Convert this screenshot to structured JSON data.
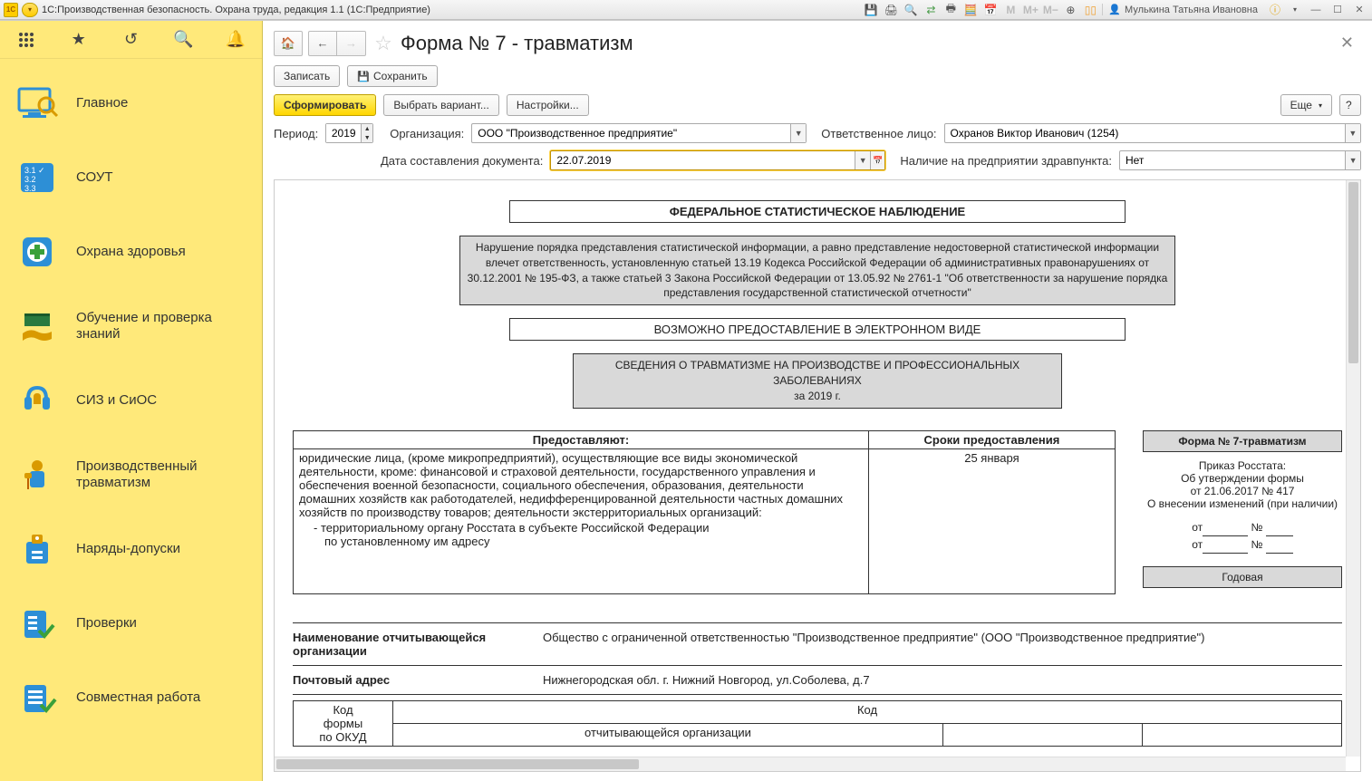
{
  "titlebar": {
    "text": "1С:Производственная безопасность. Охрана труда, редакция 1.1  (1С:Предприятие)",
    "user": "Мулькина Татьяна Ивановна"
  },
  "sidebar": {
    "items": [
      {
        "label": "Главное"
      },
      {
        "label": "СОУТ"
      },
      {
        "label": "Охрана здоровья"
      },
      {
        "label": "Обучение и проверка знаний"
      },
      {
        "label": "СИЗ и СиОС"
      },
      {
        "label": "Производственный травматизм"
      },
      {
        "label": "Наряды-допуски"
      },
      {
        "label": "Проверки"
      },
      {
        "label": "Совместная работа"
      }
    ]
  },
  "header": {
    "title": "Форма № 7 - травматизм"
  },
  "toolbar1": {
    "write": "Записать",
    "save": "Сохранить"
  },
  "toolbar2": {
    "form": "Сформировать",
    "variant": "Выбрать вариант...",
    "settings": "Настройки...",
    "more": "Еще",
    "help": "?"
  },
  "form": {
    "period_label": "Период:",
    "period_value": "2019",
    "org_label": "Организация:",
    "org_value": "ООО \"Производственное предприятие\"",
    "resp_label": "Ответственное лицо:",
    "resp_value": "Охранов Виктор Иванович (1254)",
    "docdate_label": "Дата составления документа:",
    "docdate_value": "22.07.2019",
    "medpoint_label": "Наличие на предприятии здравпункта:",
    "medpoint_value": "Нет"
  },
  "report": {
    "heading": "ФЕДЕРАЛЬНОЕ СТАТИСТИЧЕСКОЕ НАБЛЮДЕНИЕ",
    "warning": "Нарушение порядка представления статистической информации, а равно представление недостоверной статистической информации влечет ответственность, установленную статьей 13.19 Кодекса Российской Федерации об административных правонарушениях от 30.12.2001 № 195-ФЗ, а также статьей 3 Закона Российской Федерации от 13.05.92 № 2761-1 \"Об ответственности за нарушение порядка представления государственной статистической отчетности\"",
    "electronic": "ВОЗМОЖНО ПРЕДОСТАВЛЕНИЕ В ЭЛЕКТРОННОМ ВИДЕ",
    "subject_line1": "СВЕДЕНИЯ О ТРАВМАТИЗМЕ НА ПРОИЗВОДСТВЕ И ПРОФЕССИОНАЛЬНЫХ ЗАБОЛЕВАНИЯХ",
    "subject_line2": "за 2019 г.",
    "provide_hdr": "Предоставляют:",
    "deadline_hdr": "Сроки предоставления",
    "deadline_val": "25 января",
    "provide_text": "юридические лица, (кроме микропредприятий), осуществляющие все виды экономической деятельности, кроме: финансовой и страховой деятельности, государственного управления и обеспечения военной безопасности, социального обеспечения, образования, деятельности домашних хозяйств как работодателей, недифференцированной деятельности частных домашних хозяйств по производству товаров; деятельности экстерриториальных организаций:",
    "provide_sub1": "- территориальному органу Росстата в субъекте Российской Федерации",
    "provide_sub2": "по установленному им адресу",
    "form_badge": "Форма № 7-травматизм",
    "order_l1": "Приказ Росстата:",
    "order_l2": "Об утверждении формы",
    "order_l3": "от 21.06.2017 № 417",
    "order_l4": "О внесении изменений (при наличии)",
    "from": "от",
    "num": "№",
    "annual": "Годовая",
    "org_name_lbl": "Наименование отчитывающейся организации",
    "org_name_val": "Общество с ограниченной ответственностью \"Производственное предприятие\" (ООО \"Производственное предприятие\")",
    "post_lbl": "Почтовый адрес",
    "post_val": "Нижнегородская обл. г. Нижний Новгород, ул.Соболева, д.7",
    "code_col1_l1": "Код",
    "code_col1_l2": "формы",
    "code_col1_l3": "по ОКУД",
    "code_hdr": "Код",
    "code_sub": "отчитывающейся организации"
  }
}
